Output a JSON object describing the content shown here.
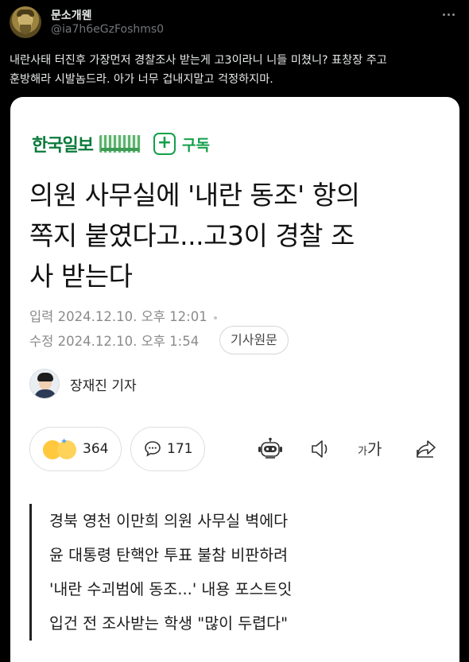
{
  "tweet": {
    "display_name": "문소개웬",
    "handle": "@ia7h6eGzFoshms0",
    "text": "내란사태 터진후 가장먼저 경찰조사 받는게 고3이라니 니들 미쳤니? 표창장 주고\n훈방해라 시발놈드라. 아가 너무 겁내지말고 걱정하지마.",
    "avatar_icon": "avatar-icon",
    "more_icon": "more-options-icon"
  },
  "article": {
    "brand": "한국일보",
    "subscribe_label": "구독",
    "headline": "의원 사무실에 '내란 동조' 항의\n쪽지 붙였다고...고3이 경찰 조\n사 받는다",
    "published": "입력 2024.12.10. 오후 12:01",
    "modified": "수정 2024.12.10. 오후 1:54",
    "original_link_label": "기사원문",
    "reporter": "장재진 기자",
    "reaction_count": "364",
    "comment_count": "171",
    "font_size_label_small": "가",
    "font_size_label_large": "가",
    "summary_lines": [
      "경북 영천 이만희 의원 사무실 벽에다",
      "윤 대통령 탄핵안 투표 불참 비판하려",
      "'내란 수괴범에 동조...' 내용 포스트잇",
      "입건 전 조사받는 학생 \"많이 두렵다\""
    ]
  },
  "colors": {
    "background": "#000000",
    "tweet_text": "#e7e9ea",
    "handle": "#71767b",
    "brand_green": "#0a7a3a",
    "subscribe_green": "#13a04a",
    "card_background": "#ffffff"
  }
}
